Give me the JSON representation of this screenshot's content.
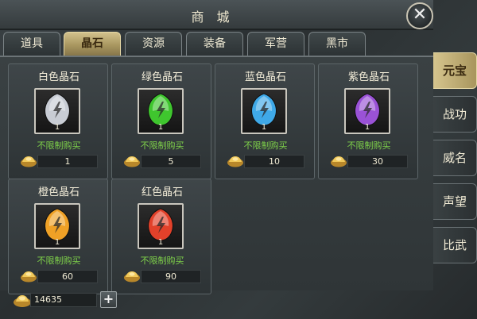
{
  "header": {
    "title": "商城",
    "close_icon": "close-icon"
  },
  "tabs": [
    {
      "label": "道具",
      "active": false
    },
    {
      "label": "晶石",
      "active": true
    },
    {
      "label": "资源",
      "active": false
    },
    {
      "label": "装备",
      "active": false
    },
    {
      "label": "军营",
      "active": false
    },
    {
      "label": "黑市",
      "active": false
    }
  ],
  "items": [
    {
      "name": "白色晶石",
      "count": "1",
      "limit": "不限制购买",
      "price": "1",
      "color": "#c8ccd4"
    },
    {
      "name": "绿色晶石",
      "count": "1",
      "limit": "不限制购买",
      "price": "5",
      "color": "#3fc62e"
    },
    {
      "name": "蓝色晶石",
      "count": "1",
      "limit": "不限制购买",
      "price": "10",
      "color": "#3fa9e8"
    },
    {
      "name": "紫色晶石",
      "count": "1",
      "limit": "不限制购买",
      "price": "30",
      "color": "#9a52d6"
    },
    {
      "name": "橙色晶石",
      "count": "1",
      "limit": "不限制购买",
      "price": "60",
      "color": "#f0a126"
    },
    {
      "name": "红色晶石",
      "count": "1",
      "limit": "不限制购买",
      "price": "90",
      "color": "#e2412a"
    }
  ],
  "currency": {
    "amount": "14635",
    "icon": "gold-ingot-icon",
    "plus_label": "+"
  },
  "side_tabs": [
    {
      "label": "元宝",
      "active": true
    },
    {
      "label": "战功",
      "active": false
    },
    {
      "label": "威名",
      "active": false
    },
    {
      "label": "声望",
      "active": false
    },
    {
      "label": "比武",
      "active": false
    }
  ],
  "colors": {
    "accent": "#c9b57a",
    "limit_text": "#7fd24a"
  }
}
